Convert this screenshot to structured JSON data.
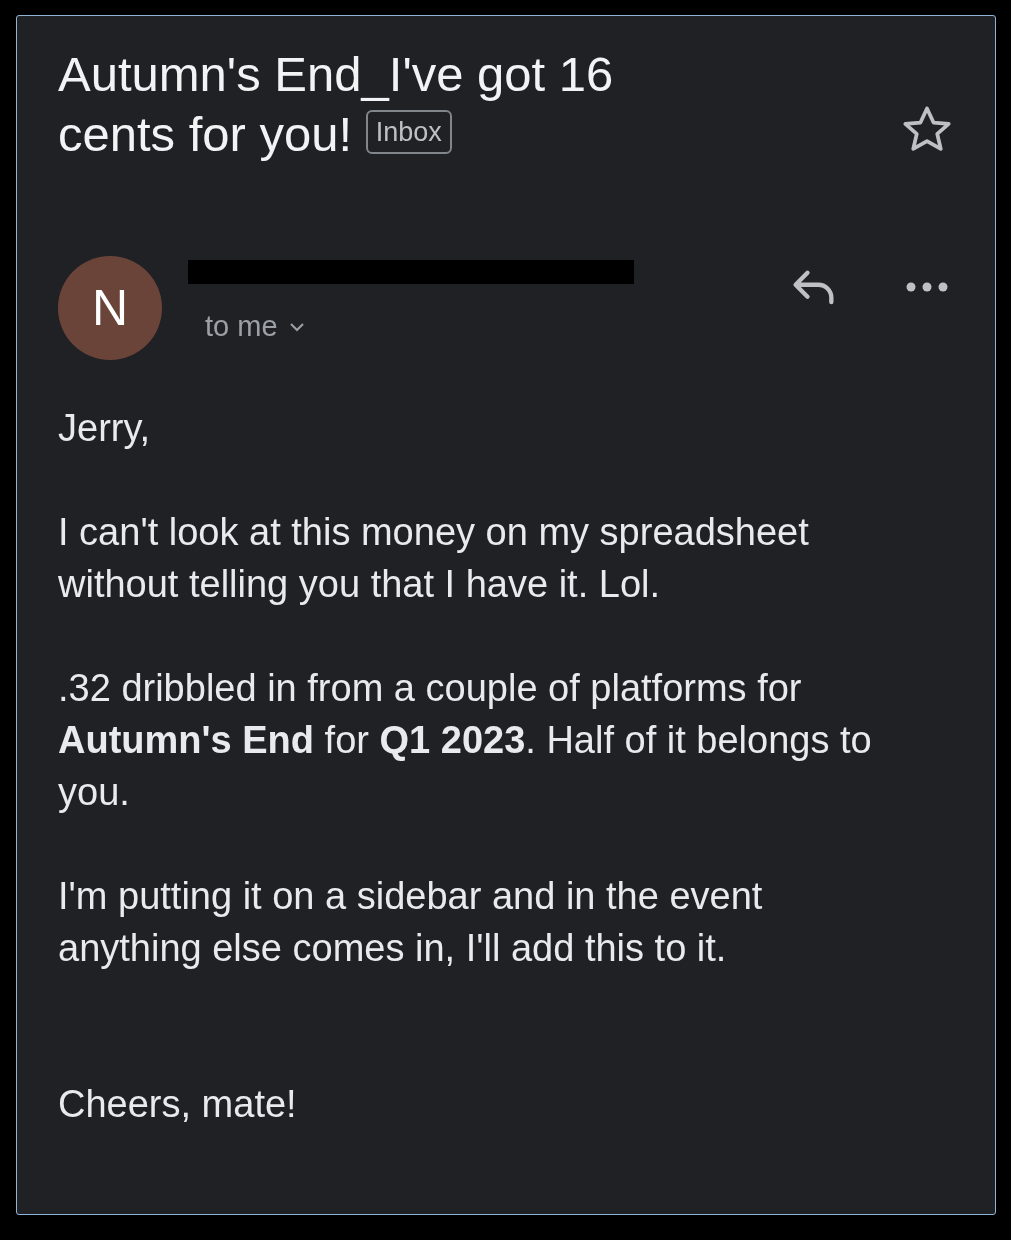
{
  "subject": {
    "title": "Autumn's End_I've got 16 cents for you!",
    "label": "Inbox",
    "starred": false
  },
  "sender": {
    "initial": "N",
    "recipient": "to me",
    "details_expanded": false
  },
  "body": [
    {
      "kind": "text",
      "text": "Jerry,"
    },
    {
      "kind": "text",
      "text": "I can't look at this money on my spreadsheet without telling you that I have it. Lol."
    },
    {
      "kind": "text",
      "text": ".32 dribbled in from a couple of platforms for **Autumn's End** for **Q1 2023**. Half of it belongs to you."
    },
    {
      "kind": "text",
      "text": "I'm putting it on a sidebar and in the event anything else comes in, I'll add this to it."
    },
    {
      "kind": "signoff",
      "text": "Cheers, mate!"
    }
  ]
}
